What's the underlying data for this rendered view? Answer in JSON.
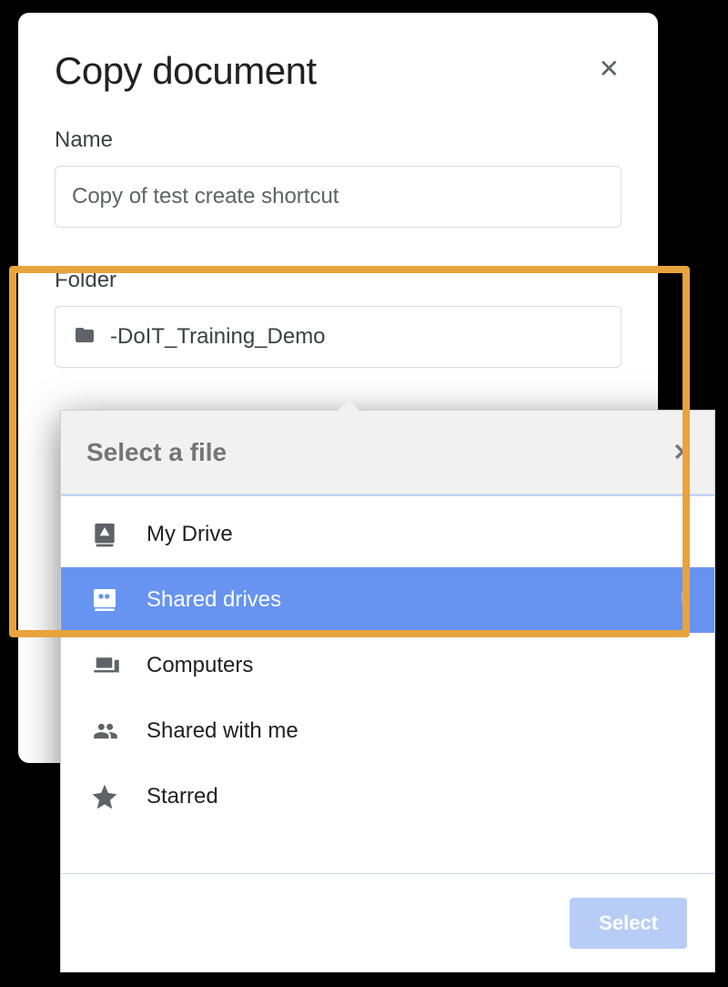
{
  "dialog": {
    "title": "Copy document",
    "name_label": "Name",
    "name_value": "Copy of test create shortcut",
    "folder_label": "Folder",
    "folder_value": "-DoIT_Training_Demo"
  },
  "picker": {
    "title": "Select a file",
    "items": [
      {
        "label": "My Drive",
        "icon": "my-drive"
      },
      {
        "label": "Shared drives",
        "icon": "shared-drives",
        "selected": true
      },
      {
        "label": "Computers",
        "icon": "computers"
      },
      {
        "label": "Shared with me",
        "icon": "shared-with-me"
      },
      {
        "label": "Starred",
        "icon": "starred"
      }
    ],
    "select_button": "Select"
  }
}
